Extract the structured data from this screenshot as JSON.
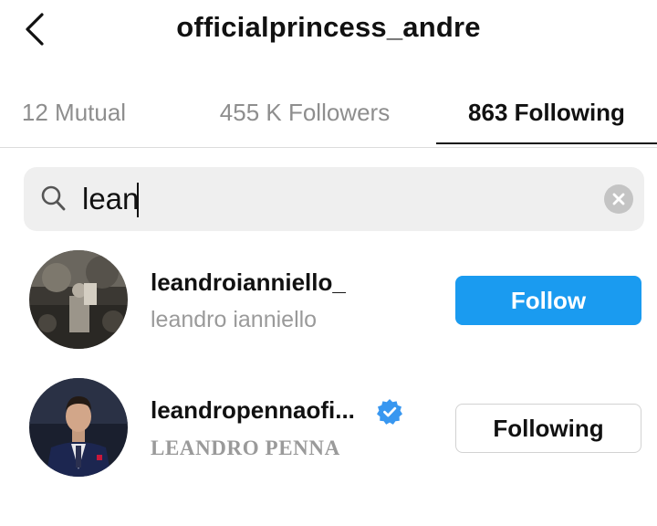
{
  "header": {
    "back_icon": "chevron-left-icon",
    "title": "officialprincess_andre"
  },
  "tabs": [
    {
      "label": "12 Mutual",
      "active": false
    },
    {
      "label": "455 K Followers",
      "active": false
    },
    {
      "label": "863 Following",
      "active": true
    }
  ],
  "search": {
    "icon": "search-icon",
    "value": "lean",
    "clear_icon": "clear-icon"
  },
  "results": [
    {
      "username": "leandroianniello_",
      "full_name": "leandro ianniello",
      "verified": false,
      "button_label": "Follow",
      "button_color": "#1a9bf0"
    },
    {
      "username": "leandropennaofi...",
      "full_name": "LEANDRO PENNA",
      "verified": true,
      "verified_color": "#3897f0",
      "button_label": "Following"
    }
  ],
  "colors": {
    "accent": "#1a9bf0",
    "muted_text": "#8e8e8e",
    "search_bg": "#efefef"
  }
}
